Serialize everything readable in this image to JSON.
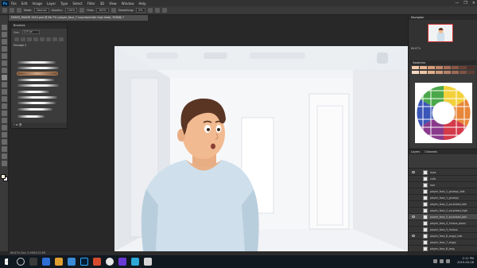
{
  "app": {
    "logo": "Ps",
    "window_controls": [
      "—",
      "❐",
      "✕"
    ]
  },
  "menu": [
    "File",
    "Edit",
    "Image",
    "Layer",
    "Type",
    "Select",
    "Filter",
    "3D",
    "View",
    "Window",
    "Help"
  ],
  "options_bar": {
    "mode_label": "Mode:",
    "mode_value": "Normal",
    "opacity_label": "Opacity:",
    "opacity_value": "100%",
    "flow_label": "Flow:",
    "flow_value": "100%",
    "smoothing_label": "Smoothing:",
    "smoothing_value": "0%"
  },
  "document_tab": "DYAR0_PAD0R 1920.psd @ 66.7% (player_face_7 surprised talk high head, RGB/8) *",
  "brush_panel": {
    "title": "Brushes",
    "size_label": "Size:",
    "size_value": "125 px",
    "folder_label": "Smudge 2",
    "footer": "• ⊞ 🗑"
  },
  "navigator": {
    "title": "Navigator",
    "zoom": "66.67%"
  },
  "swatches_title": "Swatches",
  "layers": {
    "tabs": [
      "Layers",
      "Channels"
    ],
    "rows": [
      {
        "name": "eyes",
        "visible": true
      },
      {
        "name": "coils",
        "visible": false
      },
      {
        "name": "hair",
        "visible": false
      },
      {
        "name": "player_face_1_grumpy_talk",
        "visible": false
      },
      {
        "name": "player_face_1_grumpy",
        "visible": false
      },
      {
        "name": "player_face_2_surprised_talk",
        "visible": false
      },
      {
        "name": "player_face_2_surprised_high",
        "visible": false
      },
      {
        "name": "player_face_3_surprised_talk",
        "visible": true
      },
      {
        "name": "player_face_4_furious_down",
        "visible": false
      },
      {
        "name": "player_face_5_furious",
        "visible": false
      },
      {
        "name": "player_face_6_angry_talk",
        "visible": true
      },
      {
        "name": "player_face_7_angry",
        "visible": false
      },
      {
        "name": "player_face_8_long",
        "visible": false
      }
    ]
  },
  "status_bar": "66.67%    Doc: 5.93M/212.9M",
  "taskbar": {
    "time": "2:11 PM",
    "date": "2019-05-06"
  },
  "colors": {
    "accent_selection": "#b07a4a",
    "canvas_bg": "#f4f5f7",
    "shirt": "#c9dcea",
    "hair": "#5a3524",
    "skin": "#f0b98f"
  }
}
